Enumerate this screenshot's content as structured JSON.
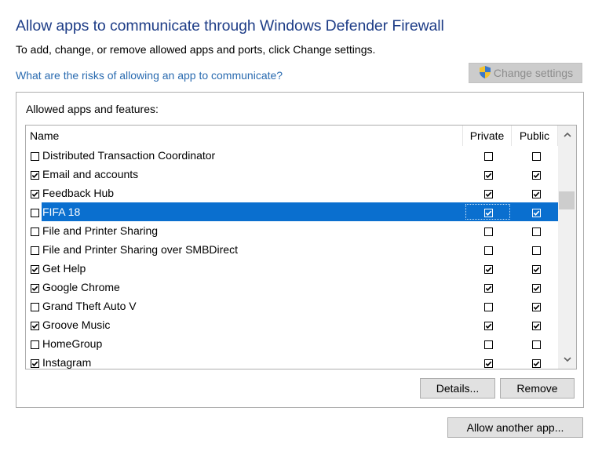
{
  "header": {
    "title": "Allow apps to communicate through Windows Defender Firewall",
    "subtitle": "To add, change, or remove allowed apps and ports, click Change settings.",
    "risk_link": "What are the risks of allowing an app to communicate?",
    "change_settings_label": "Change settings",
    "change_settings_icon": "uac-shield-icon"
  },
  "group": {
    "label": "Allowed apps and features:",
    "columns": {
      "name": "Name",
      "private": "Private",
      "public": "Public"
    },
    "rows": [
      {
        "name": "Distributed Transaction Coordinator",
        "enabled": false,
        "private": false,
        "public": false,
        "selected": false
      },
      {
        "name": "Email and accounts",
        "enabled": true,
        "private": true,
        "public": true,
        "selected": false
      },
      {
        "name": "Feedback Hub",
        "enabled": true,
        "private": true,
        "public": true,
        "selected": false
      },
      {
        "name": "FIFA 18",
        "enabled": false,
        "private": true,
        "public": true,
        "selected": true
      },
      {
        "name": "File and Printer Sharing",
        "enabled": false,
        "private": false,
        "public": false,
        "selected": false
      },
      {
        "name": "File and Printer Sharing over SMBDirect",
        "enabled": false,
        "private": false,
        "public": false,
        "selected": false
      },
      {
        "name": "Get Help",
        "enabled": true,
        "private": true,
        "public": true,
        "selected": false
      },
      {
        "name": "Google Chrome",
        "enabled": true,
        "private": true,
        "public": true,
        "selected": false
      },
      {
        "name": "Grand Theft Auto V",
        "enabled": false,
        "private": false,
        "public": true,
        "selected": false
      },
      {
        "name": "Groove Music",
        "enabled": true,
        "private": true,
        "public": true,
        "selected": false
      },
      {
        "name": "HomeGroup",
        "enabled": false,
        "private": false,
        "public": false,
        "selected": false
      },
      {
        "name": "Instagram",
        "enabled": true,
        "private": true,
        "public": true,
        "selected": false
      }
    ],
    "scroll_position_fraction": 0.25,
    "details_label": "Details...",
    "remove_label": "Remove"
  },
  "footer": {
    "allow_another_label": "Allow another app..."
  },
  "colors": {
    "title": "#1e3d87",
    "link": "#2a6bb0",
    "selection": "#0a6fcf"
  }
}
